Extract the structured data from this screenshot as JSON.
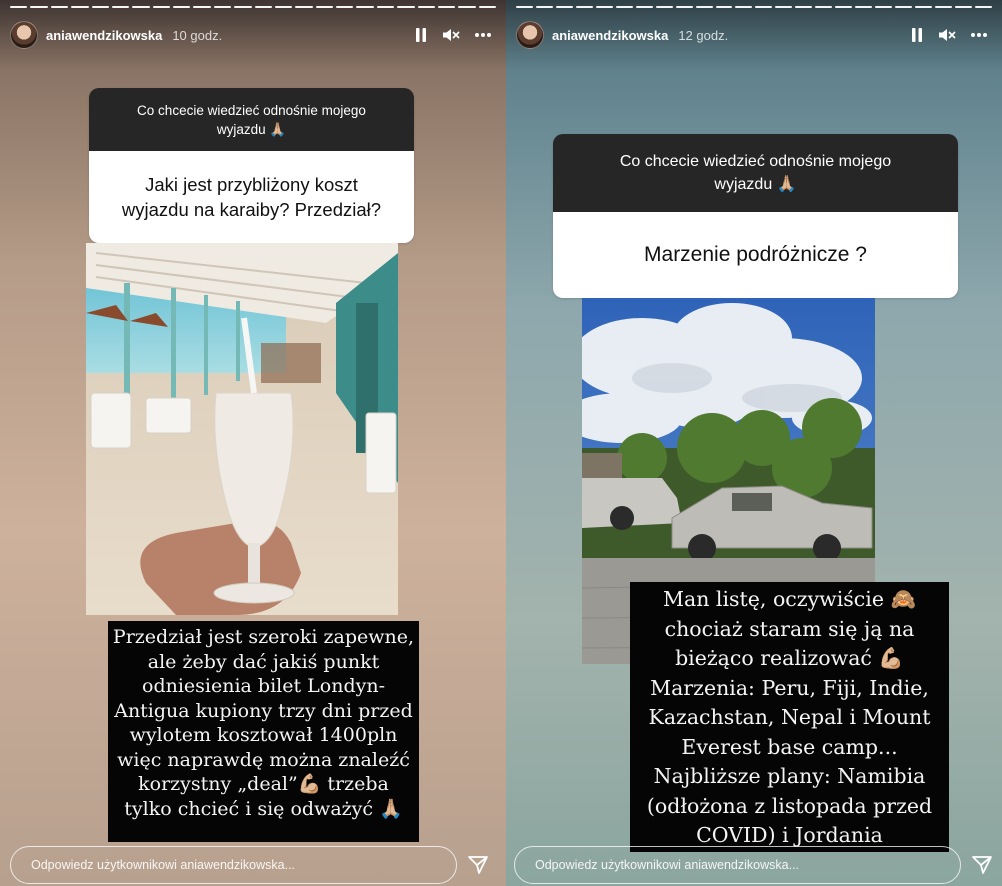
{
  "stories": {
    "left": {
      "username": "aniawendzikowska",
      "time": "10 godz.",
      "question_prompt": "Co chcecie wiedzieć odnośnie mojego wyjazdu 🙏🏼",
      "question_answer": "Jaki jest przybliżony koszt wyjazdu na karaiby? Przedział?",
      "caption": "Przedział jest szeroki zapewne, ale żeby dać jakiś punkt odniesienia bilet Londyn-Antigua kupiony trzy dni przed wylotem kosztował 1400pln więc naprawdę można znaleźć korzystny „deal”💪🏼 trzeba tylko chcieć i się odważyć 🙏🏼",
      "reply_placeholder": "Odpowiedz użytkownikowi aniawendzikowska...",
      "progress_segments": 24
    },
    "right": {
      "username": "aniawendzikowska",
      "time": "12 godz.",
      "question_prompt": "Co chcecie wiedzieć odnośnie mojego wyjazdu 🙏🏼",
      "question_answer": "Marzenie podróżnicze ?",
      "caption": "Man listę, oczywiście 🙈 chociaż staram się ją na bieżąco realizować 💪🏼 Marzenia: Peru, Fiji, Indie, Kazachstan, Nepal i Mount Everest base camp... Najbliższe plany: Namibia (odłożona z listopada przed COVID) i Jordania",
      "reply_placeholder": "Odpowiedz użytkownikowi aniawendzikowska...",
      "progress_segments": 24
    }
  },
  "icons": {
    "pause": "pause-icon",
    "mute": "speaker-muted-icon",
    "more": "more-horizontal-icon",
    "send": "paper-plane-icon"
  },
  "colors": {
    "question_header_bg": "#262626",
    "caption_bg": "#050505",
    "text_light": "#ffffff"
  }
}
